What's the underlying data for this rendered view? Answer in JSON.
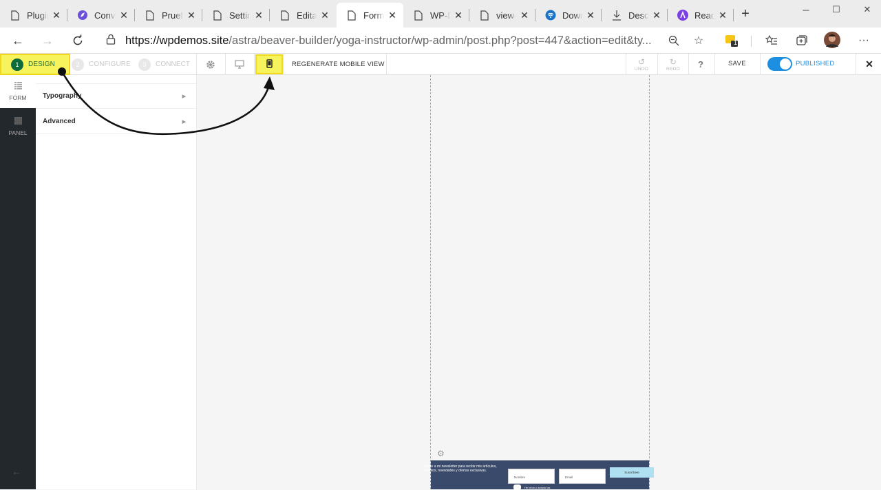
{
  "browser": {
    "tabs": [
      {
        "title": "Plugins",
        "icon": "page-icon",
        "active": false
      },
      {
        "title": "Convert",
        "icon": "compass-icon",
        "active": false
      },
      {
        "title": "Prueba",
        "icon": "page-icon",
        "active": false
      },
      {
        "title": "Settings",
        "icon": "page-icon",
        "active": false
      },
      {
        "title": "Editar",
        "icon": "page-icon",
        "active": false
      },
      {
        "title": "Formulario",
        "icon": "page-icon",
        "active": true
      },
      {
        "title": "WP-Demos",
        "icon": "page-icon",
        "active": false
      },
      {
        "title": "view-source",
        "icon": "page-icon",
        "active": false
      },
      {
        "title": "Download",
        "icon": "wifi-icon",
        "active": false
      },
      {
        "title": "Descargas",
        "icon": "download-icon",
        "active": false
      },
      {
        "title": "Ready",
        "icon": "astra-icon",
        "active": false
      }
    ],
    "url_domain": "https://wpdemos.site",
    "url_path": "/astra/beaver-builder/yoga-instructor/wp-admin/post.php?post=447&action=edit&ty...",
    "extension_badge": "1"
  },
  "toolbar": {
    "steps": [
      {
        "num": "1",
        "label": "DESIGN"
      },
      {
        "num": "2",
        "label": "CONFIGURE"
      },
      {
        "num": "3",
        "label": "CONNECT"
      }
    ],
    "regenerate_label": "REGENERATE MOBILE VIEW",
    "undo_label": "UNDO",
    "redo_label": "REDO",
    "help_label": "?",
    "save_label": "SAVE",
    "published_label": "PUBLISHED",
    "published_on": true
  },
  "rail": {
    "form_label": "FORM",
    "panel_label": "PANEL"
  },
  "panel": {
    "sections": [
      {
        "label": "Typography"
      },
      {
        "label": "Advanced"
      }
    ]
  },
  "preview": {
    "message": "Únete a mi newsletter para recibir mis artículos, eventos, novedades y ofertas exclusivas.",
    "name_placeholder": "Nombre",
    "email_placeholder": "Email",
    "subscribe_label": "Suscríbete",
    "consent_text": "He leído y acepto las"
  },
  "colors": {
    "highlight_yellow": "#f7f35d",
    "step_green": "#0e6b3b",
    "published_blue": "#1d8fe0",
    "rail_dark": "#23282d",
    "optin_bg": "#3a4a6b",
    "guide_cyan": "#56c2e6"
  }
}
